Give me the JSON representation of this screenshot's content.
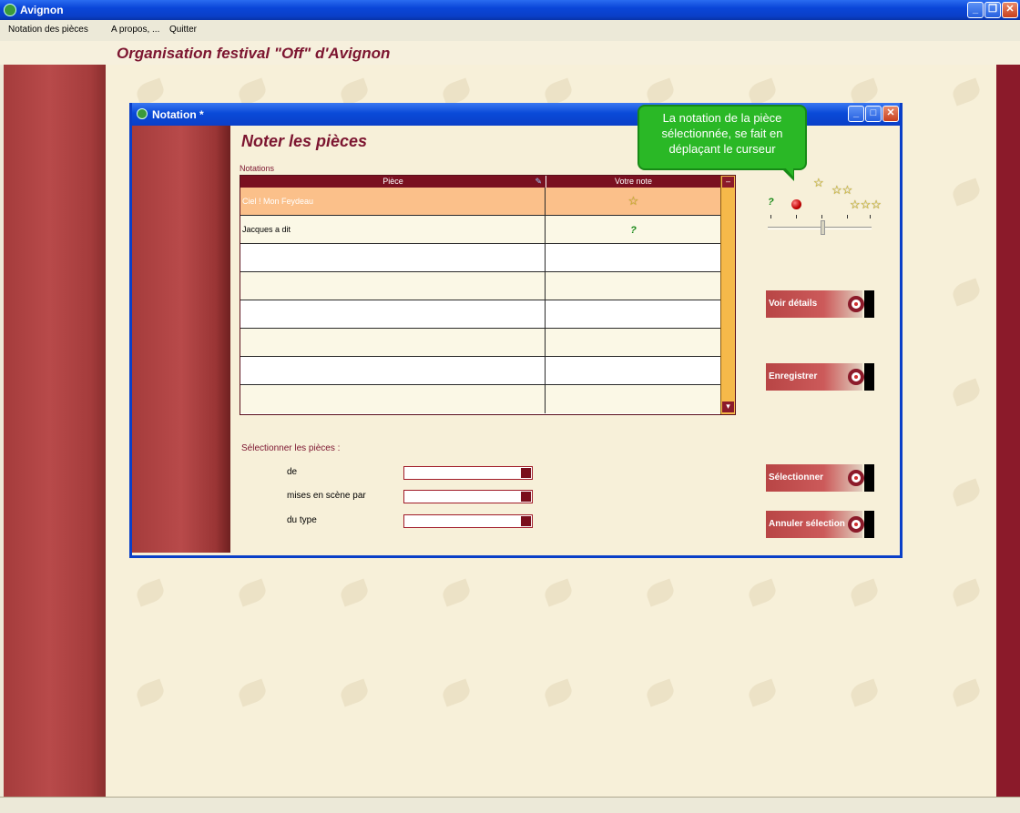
{
  "app": {
    "title": "Avignon",
    "heading": "Organisation festival \"Off\" d'Avignon",
    "accent_color": "#7c1530",
    "titlebar_color": "#0a3fc8"
  },
  "menu": {
    "items": [
      "Notation des pièces",
      "A propos, ...",
      "Quitter"
    ]
  },
  "window_controls": [
    "minimize-icon",
    "restore-icon",
    "close-icon"
  ],
  "child_window": {
    "title": "Notation *",
    "section_title": "Noter les pièces",
    "table_label": "Notations",
    "columns": [
      "Pièce",
      "Votre note"
    ],
    "rows": [
      {
        "piece": "Ciel ! Mon Feydeau",
        "note": "☆",
        "selected": true
      },
      {
        "piece": "Jacques a dit",
        "note": "?",
        "selected": false
      },
      {
        "piece": "",
        "note": ""
      },
      {
        "piece": "",
        "note": ""
      },
      {
        "piece": "",
        "note": ""
      },
      {
        "piece": "",
        "note": ""
      },
      {
        "piece": "",
        "note": ""
      },
      {
        "piece": "",
        "note": ""
      }
    ],
    "rating": {
      "levels": [
        "?",
        "☆",
        "☆☆",
        "☆☆☆"
      ],
      "current_level": 1
    },
    "tooltip": "La notation de la pièce sélectionnée, se fait en déplaçant le curseur",
    "buttons": {
      "details": "Voir détails",
      "save": "Enregistrer",
      "select": "Sélectionner",
      "cancel_select": "Annuler sélection"
    },
    "filter": {
      "title": "Sélectionner les pièces :",
      "label_author": "de",
      "label_director": "mises en scène par",
      "label_type": "du type",
      "value_author": "",
      "value_director": "",
      "value_type": ""
    }
  }
}
